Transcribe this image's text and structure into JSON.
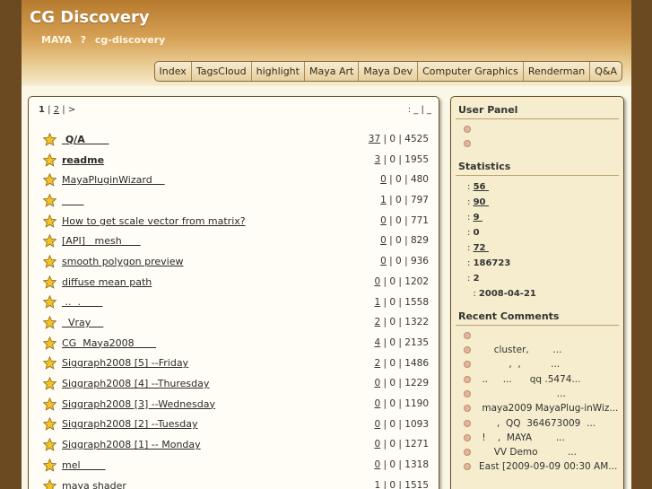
{
  "site": {
    "title": "CG Discovery",
    "subtitle": "MAYA   ?  cg-discovery"
  },
  "nav": [
    "Index",
    "TagsCloud",
    "highlight",
    "Maya Art",
    "Maya Dev",
    "Computer Graphics",
    "Renderman",
    "Q&A"
  ],
  "pager": {
    "current": "1",
    "sep1": " | ",
    "next_page": "2",
    "sep2": " | ",
    "more": ">",
    "right": ": _ | _"
  },
  "topics": [
    {
      "title": " Q/A       ",
      "bold": true,
      "count": "37",
      "rest": " | 0 | 4525"
    },
    {
      "title": "readme",
      "bold": true,
      "count": "3",
      "rest": " | 0 | 1955"
    },
    {
      "title": "MayaPluginWizard    ",
      "bold": false,
      "count": "0",
      "rest": " | 0 | 480"
    },
    {
      "title": "       ",
      "bold": false,
      "count": "1",
      "rest": " | 0 | 797"
    },
    {
      "title": "How to get scale vector from matrix?",
      "bold": false,
      "count": "0",
      "rest": " | 0 | 771"
    },
    {
      "title": "[API]   mesh      ",
      "bold": false,
      "count": "0",
      "rest": " | 0 | 829"
    },
    {
      "title": "smooth polygon preview",
      "bold": false,
      "count": "0",
      "rest": " | 0 | 936"
    },
    {
      "title": "diffuse mean path",
      "bold": false,
      "count": "0",
      "rest": " | 0 | 1202"
    },
    {
      "title": " ..  .       ",
      "bold": false,
      "count": "1",
      "rest": " | 0 | 1558"
    },
    {
      "title": "  Vray    ",
      "bold": false,
      "count": "2",
      "rest": " | 0 | 1322"
    },
    {
      "title": "CG  Maya2008       ",
      "bold": false,
      "count": "4",
      "rest": " | 0 | 2135"
    },
    {
      "title": "Siggraph2008 [5] --Friday",
      "bold": false,
      "count": "2",
      "rest": " | 0 | 1486"
    },
    {
      "title": "Siggraph2008 [4] --Thuresday",
      "bold": false,
      "count": "0",
      "rest": " | 0 | 1229"
    },
    {
      "title": "Siggraph2008 [3] --Wednesday",
      "bold": false,
      "count": "0",
      "rest": " | 0 | 1190"
    },
    {
      "title": "Siggraph2008 [2] --Tuesday",
      "bold": false,
      "count": "0",
      "rest": " | 0 | 1093"
    },
    {
      "title": "Siggraph2008 [1] -- Monday",
      "bold": false,
      "count": "0",
      "rest": " | 0 | 1271"
    },
    {
      "title": "mel        ",
      "bold": false,
      "count": "0",
      "rest": " | 0 | 1318"
    },
    {
      "title": "maya shader",
      "bold": false,
      "count": "1",
      "rest": " | 0 | 1515"
    }
  ],
  "sidebar": {
    "user_panel_title": "User Panel",
    "statistics_title": "Statistics",
    "statistics": [
      {
        "prefix": ": ",
        "value": "56 ",
        "link": true
      },
      {
        "prefix": ": ",
        "value": "90 ",
        "link": true
      },
      {
        "prefix": ": ",
        "value": "9 ",
        "link": true
      },
      {
        "prefix": ": ",
        "value": "0",
        "link": false
      },
      {
        "prefix": ": ",
        "value": "72 ",
        "link": true
      },
      {
        "prefix": ": ",
        "value": "186723",
        "link": false
      },
      {
        "prefix": ": ",
        "value": "2",
        "link": false
      },
      {
        "prefix": "  : ",
        "value": "2008-04-21",
        "link": false
      }
    ],
    "recent_title": "Recent Comments",
    "recent": [
      "",
      "     cluster,        ...",
      "          ,  ,          ...",
      " ..     ...      qq .5474...",
      "                          ...",
      " maya2009 MayaPlug-inWiz...",
      "      ,  QQ  364673009  ...",
      " !    ,  MAYA        ...",
      "     VV Demo          ...",
      "East [2009-09-09 00:30 AM..."
    ]
  },
  "colors": {
    "header_top": "#b67a2e",
    "header_bottom": "#f6ecd2",
    "frame": "#6b4a22",
    "content_bg": "#fbf7e6",
    "sidebar_bg": "#f5edcd",
    "star": "#f1c22a"
  }
}
